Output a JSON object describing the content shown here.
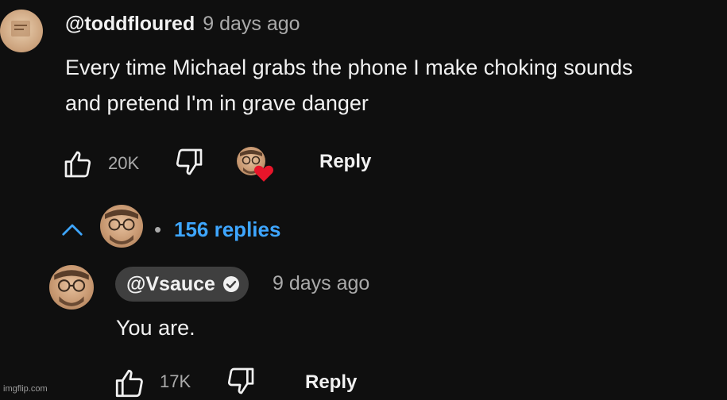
{
  "comment": {
    "author": "@toddfloured",
    "time": "9 days ago",
    "text_line1": "Every time Michael grabs the phone I make choking sounds",
    "text_line2": "and pretend I'm in grave danger",
    "likes": "20K",
    "reply_label": "Reply",
    "hearted_by_creator": true
  },
  "replies_toggle": {
    "separator": "•",
    "label": "156 replies"
  },
  "reply": {
    "author": "@Vsauce",
    "verified": true,
    "time": "9 days ago",
    "text": "You are.",
    "likes": "17K",
    "reply_label": "Reply"
  },
  "watermark": "imgflip.com",
  "colors": {
    "background": "#0f0f0f",
    "link_blue": "#3ea6ff",
    "heart_red": "#e8152a",
    "pill_bg": "#3f3f3f",
    "muted": "#aaaaaa"
  },
  "icons": [
    "like-icon",
    "dislike-icon",
    "heart-icon",
    "chevron-up-icon",
    "verified-check-icon"
  ]
}
